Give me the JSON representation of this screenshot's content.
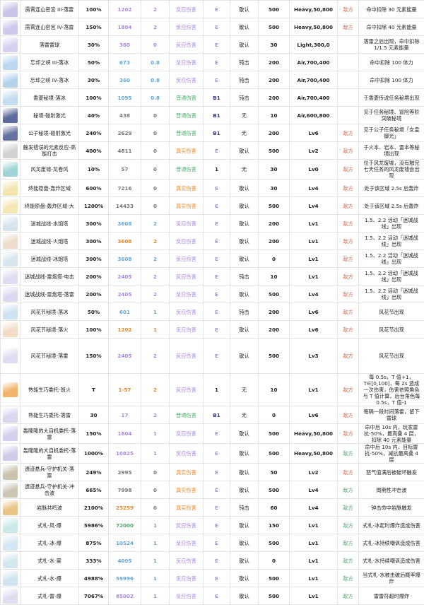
{
  "rows": [
    {
      "icon": "lightning-portrait-icon",
      "tint": "#c9c4e6",
      "name": "雳霄连山密宫 III-落雷",
      "pct": "100%",
      "val": "1202",
      "vc": "c-purple",
      "lvl": "2",
      "lc": "c-purple",
      "type": "反应伤害",
      "tc": "c-purple",
      "elem": "E",
      "ec": "c-purple",
      "inter": "散认",
      "gauge": "500",
      "tag": "Heavy,50,800",
      "team": "敌方",
      "teamc": "c-red",
      "desc": "命中扣除 30 元素能量"
    },
    {
      "icon": "lightning-portrait-icon",
      "tint": "#cdc8ea",
      "name": "雳霄连山密宫 IV-落雷",
      "pct": "150%",
      "val": "1804",
      "vc": "c-purple",
      "lvl": "2",
      "lc": "c-purple",
      "type": "反应伤害",
      "tc": "c-purple",
      "elem": "E",
      "ec": "c-purple",
      "inter": "散认",
      "gauge": "500",
      "tag": "Heavy,50,800",
      "team": "敌方",
      "teamc": "c-red",
      "desc": "命中扣除 40 元素能量"
    },
    {
      "icon": "lightning-portrait-icon",
      "tint": "#d6d1ee",
      "name": "落雷雷球",
      "pct": "30%",
      "val": "360",
      "vc": "c-purple",
      "lvl": "0",
      "lc": "c-purple",
      "type": "反应伤害",
      "tc": "c-purple",
      "elem": "E",
      "ec": "c-purple",
      "inter": "散认",
      "gauge": "30",
      "tag": "Light,300,0",
      "team": "",
      "teamc": "c-red",
      "desc": "落雷之后出现，命中扣除 1/1.5 元素能量"
    },
    {
      "icon": "ice-portrait-icon",
      "tint": "#bcd7ef",
      "name": "忘却之峡 III-落冰",
      "pct": "50%",
      "val": "673",
      "vc": "c-blue",
      "lvl": "0.8",
      "lc": "c-blue",
      "type": "反应伤害",
      "tc": "c-purple",
      "elem": "E",
      "ec": "c-purple",
      "inter": "钝击",
      "gauge": "200",
      "tag": "Air,700,400",
      "team": "",
      "teamc": "c-red",
      "desc": "命中扣除 100 体力"
    },
    {
      "icon": "ice-portrait-icon",
      "tint": "#b6d3ec",
      "name": "忘却之峡 IV-落冰",
      "pct": "30%",
      "val": "360",
      "vc": "c-blue",
      "lvl": "0.8",
      "lc": "c-blue",
      "type": "反应伤害",
      "tc": "c-purple",
      "elem": "E",
      "ec": "c-purple",
      "inter": "钝击",
      "gauge": "200",
      "tag": "Air,700,400",
      "team": "",
      "teamc": "c-red",
      "desc": "命中扣除 100 体力"
    },
    {
      "icon": "ice-portrait-icon",
      "tint": "#c4dcef",
      "name": "香菱秘境-落冰",
      "pct": "100%",
      "val": "1095",
      "vc": "c-blue",
      "lvl": "0.8",
      "lc": "c-blue",
      "type": "普通伤害",
      "tc": "c-green",
      "elem": "B1",
      "ec": "c-navy",
      "inter": "钝击",
      "gauge": "200",
      "tag": "Air,700,400",
      "team": "",
      "teamc": "c-red",
      "desc": "于香菱传说任务秘境出现"
    },
    {
      "icon": "laser-portrait-icon",
      "tint": "#5d6b9c",
      "name": "秘境-碰射激光",
      "pct": "40%",
      "val": "438",
      "vc": "c-gray",
      "lvl": "0",
      "lc": "c-gray",
      "type": "普通伤害",
      "tc": "c-green",
      "elem": "B1",
      "ec": "c-navy",
      "inter": "无",
      "gauge": "10",
      "tag": "Air,600,800",
      "team": "",
      "teamc": "c-red",
      "desc": "见于任务秘境、冒险等阶突破秘境"
    },
    {
      "icon": "laser-portrait-icon",
      "tint": "#66739f",
      "name": "公子秘境-碰射激光",
      "pct": "240%",
      "val": "2629",
      "vc": "c-gray",
      "lvl": "0",
      "lc": "c-gray",
      "type": "普通伤害",
      "tc": "c-green",
      "elem": "B1",
      "ec": "c-navy",
      "inter": "无",
      "gauge": "200",
      "tag": "Lv6",
      "team": "敌方",
      "teamc": "c-red",
      "desc": "见于公子任务秘境「女皇御光」"
    },
    {
      "icon": "trap-portrait-icon",
      "tint": "#d2d2d2",
      "name": "触发错误的元素反应-高能打击",
      "pct": "400%",
      "val": "4811",
      "vc": "c-gray",
      "lvl": "0",
      "lc": "c-gray",
      "type": "真实伤害",
      "tc": "c-orange",
      "elem": "E",
      "ec": "c-purple",
      "inter": "散认",
      "gauge": "500",
      "tag": "Lv2",
      "team": "敌方",
      "teamc": "c-red",
      "desc": "于火本、岩本、雷本等秘境出现"
    },
    {
      "icon": "wind-portrait-icon",
      "tint": "#9fd4d6",
      "name": "风龙废墟-龙卷风",
      "pct": "10%",
      "val": "57",
      "vc": "c-gray",
      "lvl": "0",
      "lc": "c-gray",
      "type": "普通伤害",
      "tc": "c-green",
      "elem": "1",
      "ec": "c-dark",
      "inter": "无",
      "gauge": "30",
      "tag": "Lv0",
      "team": "敌方",
      "teamc": "c-red",
      "desc": "位于风龙废墟，没有触完七天任务的风龙废墟会出现"
    },
    {
      "icon": "pillar-portrait-icon",
      "tint": "#f3e5b0",
      "name": "终能原盘-轰炸区域",
      "pct": "600%",
      "val": "7216",
      "vc": "c-gray",
      "lvl": "0",
      "lc": "c-gray",
      "type": "真实伤害",
      "tc": "c-orange",
      "elem": "E",
      "ec": "c-purple",
      "inter": "散认",
      "gauge": "30",
      "tag": "Lv4",
      "team": "敌方",
      "teamc": "c-red",
      "desc": "处于该区域 2.5s 后轰炸"
    },
    {
      "icon": "pillar-portrait-icon",
      "tint": "#f4e7b4",
      "name": "终能原盘-轰炸区域-大",
      "pct": "1200%",
      "val": "14433",
      "vc": "c-gray",
      "lvl": "0",
      "lc": "c-gray",
      "type": "真实伤害",
      "tc": "c-orange",
      "elem": "E",
      "ec": "c-purple",
      "inter": "散认",
      "gauge": "500",
      "tag": "Lv4",
      "team": "敌方",
      "teamc": "c-red",
      "desc": "处于该区域 2.5s 后轰炸"
    },
    {
      "icon": "turret-portrait-icon",
      "tint": "#d7e4ec",
      "name": "迷城战线-水炮塔",
      "pct": "300%",
      "val": "3608",
      "vc": "c-blue",
      "lvl": "2",
      "lc": "c-blue",
      "type": "反应伤害",
      "tc": "c-purple",
      "elem": "E",
      "ec": "c-purple",
      "inter": "散认",
      "gauge": "200",
      "tag": "Lv1",
      "team": "敌方",
      "teamc": "c-red",
      "desc": "1.5、2.2 活动「迷城战线」出现"
    },
    {
      "icon": "turret-portrait-icon",
      "tint": "#eddccb",
      "name": "迷城战线-火炮塔",
      "pct": "300%",
      "val": "3608",
      "vc": "c-orange",
      "lvl": "2",
      "lc": "c-orange",
      "type": "反应伤害",
      "tc": "c-purple",
      "elem": "E",
      "ec": "c-purple",
      "inter": "散认",
      "gauge": "200",
      "tag": "Lv1",
      "team": "敌方",
      "teamc": "c-red",
      "desc": "1.5、2.2 活动「迷城战线」出现"
    },
    {
      "icon": "turret-portrait-icon",
      "tint": "#d7e6ee",
      "name": "迷城战线-冰炮塔",
      "pct": "300%",
      "val": "3608",
      "vc": "c-blue",
      "lvl": "2",
      "lc": "c-blue",
      "type": "反应伤害",
      "tc": "c-purple",
      "elem": "E",
      "ec": "c-purple",
      "inter": "散认",
      "gauge": "0",
      "tag": "Lv1",
      "team": "敌方",
      "teamc": "c-red",
      "desc": "1.5、2.2 活动「迷城战线」出现"
    },
    {
      "icon": "turret-portrait-icon",
      "tint": "#e1dbef",
      "name": "迷城战线-雷炮塔-电击",
      "pct": "200%",
      "val": "2405",
      "vc": "c-purple",
      "lvl": "2",
      "lc": "c-purple",
      "type": "反应伤害",
      "tc": "c-purple",
      "elem": "E",
      "ec": "c-purple",
      "inter": "钝击",
      "gauge": "10",
      "tag": "Lv1",
      "team": "敌方",
      "teamc": "c-red",
      "desc": "1.5、2.2 活动「迷城战线」出现"
    },
    {
      "icon": "turret-portrait-icon",
      "tint": "#ddd8ef",
      "name": "迷城战线-雷炮塔-落雷",
      "pct": "200%",
      "val": "2405",
      "vc": "c-purple",
      "lvl": "2",
      "lc": "c-purple",
      "type": "反应伤害",
      "tc": "c-purple",
      "elem": "E",
      "ec": "c-purple",
      "inter": "散认",
      "gauge": "500",
      "tag": "Lv4",
      "team": "敌方",
      "teamc": "c-red",
      "desc": "1.5、2.2 活动「迷城战线」出现"
    },
    {
      "icon": "festival-portrait-icon",
      "tint": "#cfe2f1",
      "name": "风花节秘境-落冰",
      "pct": "50%",
      "val": "601",
      "vc": "c-blue",
      "lvl": "1",
      "lc": "c-blue",
      "type": "反应伤害",
      "tc": "c-purple",
      "elem": "E",
      "ec": "c-purple",
      "inter": "钝击",
      "gauge": "200",
      "tag": "Lv6",
      "team": "敌方",
      "teamc": "c-red",
      "desc": "风花节出现"
    },
    {
      "icon": "festival-portrait-icon",
      "tint": "#f2dcc6",
      "name": "风花节秘境-落火",
      "pct": "100%",
      "val": "1202",
      "vc": "c-orange",
      "lvl": "1",
      "lc": "c-orange",
      "type": "反应伤害",
      "tc": "c-purple",
      "elem": "E",
      "ec": "c-purple",
      "inter": "散认",
      "gauge": "200",
      "tag": "Lv6",
      "team": "敌方",
      "teamc": "c-red",
      "desc": "风花节出现"
    },
    {
      "icon": "festival-portrait-icon",
      "tint": "#e1dbf0",
      "name": "风花节秘境-落雷",
      "pct": "150%",
      "val": "2405",
      "vc": "c-purple",
      "lvl": "2",
      "lc": "c-purple",
      "type": "反应伤害",
      "tc": "c-purple",
      "elem": "E",
      "ec": "c-purple",
      "inter": "散认",
      "gauge": "500",
      "tag": "Lv3",
      "team": "敌方",
      "teamc": "c-red",
      "desc": "风花节出现"
    },
    {
      "icon": "fire-portrait-icon",
      "tint": "#f0b46a",
      "name": "熟能生巧委托-斑火",
      "pct": "T",
      "val": "1-57",
      "vc": "c-orange",
      "lvl": "2",
      "lc": "c-orange",
      "type": "反应伤害",
      "tc": "c-purple",
      "elem": "1",
      "ec": "c-dark",
      "inter": "无",
      "gauge": "10",
      "tag": "Lv1",
      "team": "敌方",
      "teamc": "c-red",
      "desc": "每 0.5s，T 值+1，T∈[0,100]，每 2s 造成一次伤害，伤害依照角色与 T 值计算，后台角色每 0.5s，T 值-1"
    },
    {
      "icon": "lightning-portrait-icon",
      "tint": "#d9d6ee",
      "name": "熟能生巧委托-落雷",
      "pct": "30",
      "val": "17",
      "vc": "c-purple",
      "lvl": "2",
      "lc": "c-purple",
      "type": "普通伤害",
      "tc": "c-green",
      "elem": "B1",
      "ec": "c-navy",
      "inter": "无",
      "gauge": "0",
      "tag": "Lv6",
      "team": "敌方",
      "teamc": "c-red",
      "desc": "每隔一段时间落雷，留下雷球"
    },
    {
      "icon": "lightning-portrait-icon",
      "tint": "#d4cfeb",
      "name": "轰隆隆的大自机委托-落雷",
      "pct": "150%",
      "val": "1804",
      "vc": "c-purple",
      "lvl": "1",
      "lc": "c-purple",
      "type": "反应伤害",
      "tc": "c-purple",
      "elem": "E",
      "ec": "c-purple",
      "inter": "散认",
      "gauge": "500",
      "tag": "Heavy,50,800",
      "team": "敌方",
      "teamc": "c-red",
      "desc": "命中后 10s 内，玩家雷抗-50%，最高叠 4 层，扣除 40 元素能量"
    },
    {
      "icon": "lightning-portrait-icon",
      "tint": "#cfcae9",
      "name": "轰隆隆的大自机委托-落雷",
      "pct": "1000%",
      "val": "10825",
      "vc": "c-purple",
      "lvl": "1",
      "lc": "c-purple",
      "type": "反应伤害",
      "tc": "c-purple",
      "elem": "E",
      "ec": "c-purple",
      "inter": "散认",
      "gauge": "500",
      "tag": "Heavy,50,800",
      "team": "敌方",
      "teamc": "c-green",
      "desc": "命中后 10s 内，目标雷抗-50%，减抗最高叠 4 层"
    },
    {
      "icon": "guardian-portrait-icon",
      "tint": "#c9c2ae",
      "name": "遗迹悬兵-守护机关-落雷",
      "pct": "249%",
      "val": "2995",
      "vc": "c-gray",
      "lvl": "0",
      "lc": "c-gray",
      "type": "真实伤害",
      "tc": "c-orange",
      "elem": "E",
      "ec": "c-purple",
      "inter": "散认",
      "gauge": "50",
      "tag": "Lv2",
      "team": "敌方",
      "teamc": "c-red",
      "desc": "怒气值满后被破坏触发"
    },
    {
      "icon": "guardian-portrait-icon",
      "tint": "#cbc5b3",
      "name": "遗迹悬兵-守护机关-冲击波",
      "pct": "665%",
      "val": "7998",
      "vc": "c-gray",
      "lvl": "0",
      "lc": "c-gray",
      "type": "真实伤害",
      "tc": "c-orange",
      "elem": "E",
      "ec": "c-purple",
      "inter": "散认",
      "gauge": "500",
      "tag": "Lv4",
      "team": "敌方",
      "teamc": "c-green",
      "desc": "周期性冲击波"
    },
    {
      "icon": "rock-portrait-icon",
      "tint": "#e8c587",
      "name": "岩脉共鸣波",
      "pct": "2100%",
      "val": "25259",
      "vc": "c-orange",
      "lvl": "0",
      "lc": "c-gray",
      "type": "真实伤害",
      "tc": "c-orange",
      "elem": "E",
      "ec": "c-purple",
      "inter": "钝击",
      "gauge": "60",
      "tag": "Lv4",
      "team": "敌方",
      "teamc": "c-green",
      "desc": "钟击命中岩脉触发"
    },
    {
      "icon": "ward-portrait-icon",
      "tint": "#cbe9e6",
      "name": "式札-风-爆",
      "pct": "5986%",
      "val": "72000",
      "vc": "c-green",
      "lvl": "1",
      "lc": "c-blue",
      "type": "反应伤害",
      "tc": "c-purple",
      "elem": "E",
      "ec": "c-purple",
      "inter": "散认",
      "gauge": "150",
      "tag": "Lv1",
      "team": "敌方",
      "teamc": "c-green",
      "desc": "式札-冰起时爆炸造成伤害"
    },
    {
      "icon": "ward-portrait-icon",
      "tint": "#d3e6f1",
      "name": "式札-冰-爆",
      "pct": "875%",
      "val": "10524",
      "vc": "c-blue",
      "lvl": "1",
      "lc": "c-blue",
      "type": "反应伤害",
      "tc": "c-purple",
      "elem": "E",
      "ec": "c-purple",
      "inter": "散认",
      "gauge": "500",
      "tag": "Lv1",
      "team": "敌方",
      "teamc": "c-green",
      "desc": "式札-冰持续嘲讽造成伤害"
    },
    {
      "icon": "ward-portrait-icon",
      "tint": "#d4e6f0",
      "name": "式札-水-雾",
      "pct": "333%",
      "val": "4005",
      "vc": "c-blue",
      "lvl": "1",
      "lc": "c-blue",
      "type": "反应伤害",
      "tc": "c-purple",
      "elem": "E",
      "ec": "c-purple",
      "inter": "散认",
      "gauge": "0",
      "tag": "Lv1",
      "team": "敌方",
      "teamc": "c-green",
      "desc": "式札-水持续嘲讽造成伤害"
    },
    {
      "icon": "ward-portrait-icon",
      "tint": "#d0e4ef",
      "name": "式札-水-爆",
      "pct": "4988%",
      "val": "59996",
      "vc": "c-blue",
      "lvl": "1",
      "lc": "c-blue",
      "type": "反应伤害",
      "tc": "c-purple",
      "elem": "E",
      "ec": "c-purple",
      "inter": "散认",
      "gauge": "500",
      "tag": "Lv1",
      "team": "敌方",
      "teamc": "c-green",
      "desc": "当式札-水被击破后概率爆炸"
    },
    {
      "icon": "ward-portrait-icon",
      "tint": "#e0dcf0",
      "name": "式札-雷-爆",
      "pct": "7067%",
      "val": "85002",
      "vc": "c-purple",
      "lvl": "1",
      "lc": "c-purple",
      "type": "反应伤害",
      "tc": "c-purple",
      "elem": "E",
      "ec": "c-purple",
      "inter": "散认",
      "gauge": "500",
      "tag": "Lv1",
      "team": "敌方",
      "teamc": "c-green",
      "desc": "雷雷符超时爆炸"
    }
  ]
}
